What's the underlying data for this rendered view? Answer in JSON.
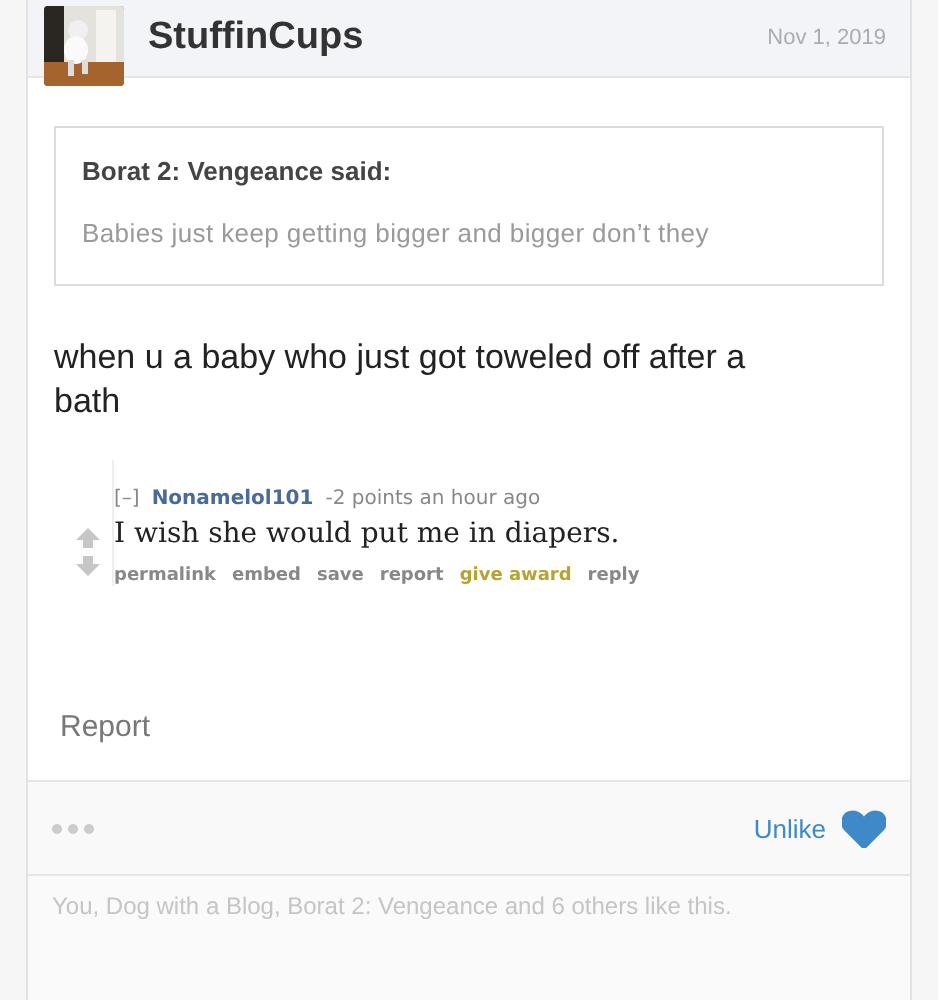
{
  "post": {
    "author": "StuffinCups",
    "date": "Nov 1, 2019",
    "quote": {
      "author": "Borat 2: Vengeance said:",
      "text": "Babies just keep getting bigger and bigger don’t they"
    },
    "body": "when u a baby who just got toweled off after a bath",
    "embedded_comment": {
      "collapse": "[–]",
      "user": "Nonamelol101",
      "meta": "-2 points an hour ago",
      "text": "I wish she would put me in diapers.",
      "links": [
        {
          "label": "permalink",
          "kind": "plain"
        },
        {
          "label": "embed",
          "kind": "plain"
        },
        {
          "label": "save",
          "kind": "plain"
        },
        {
          "label": "report",
          "kind": "plain"
        },
        {
          "label": "give award",
          "kind": "award"
        },
        {
          "label": "reply",
          "kind": "plain"
        }
      ]
    },
    "report": "Report"
  },
  "footer": {
    "like_label": "Unlike",
    "liked": true
  },
  "likes": "You, Dog with a Blog, Borat 2: Vengeance and 6 others like this."
}
